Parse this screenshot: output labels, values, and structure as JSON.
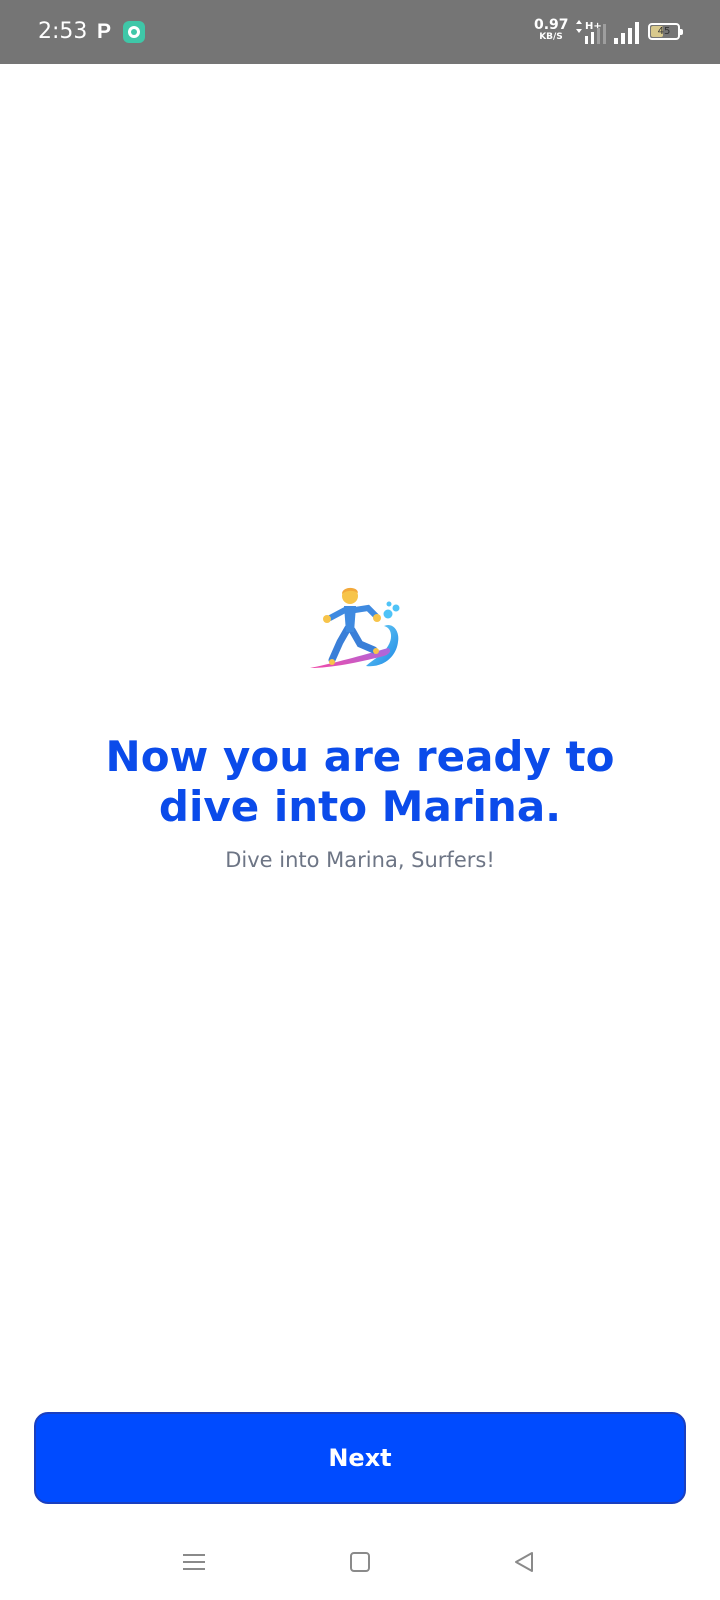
{
  "status_bar": {
    "time": "2:53",
    "app_letter": "P",
    "app_icon": "chat-bubble-icon",
    "net_speed_value": "0.97",
    "net_speed_unit": "KB/S",
    "network_type": "H+",
    "signal_icon": "signal-bars-icon",
    "battery_level": "45",
    "battery_fraction": 0.45
  },
  "content": {
    "hero_icon": "surfer-icon",
    "headline": "Now you are ready to dive into Marina.",
    "subtitle": "Dive into Marina, Surfers!"
  },
  "actions": {
    "next_label": "Next"
  },
  "nav_bar": {
    "menu_icon": "menu-icon",
    "home_icon": "home-square-icon",
    "back_icon": "back-triangle-icon"
  },
  "colors": {
    "accent": "#004bff",
    "headline": "#0b4bea",
    "subtitle": "#6d7585",
    "status_bar": "#757575"
  }
}
